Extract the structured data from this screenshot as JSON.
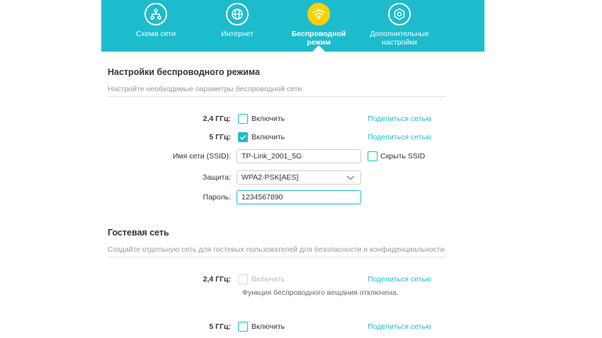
{
  "nav": {
    "items": [
      {
        "label": "Схема сети",
        "icon": "network-map-icon"
      },
      {
        "label": "Интернет",
        "icon": "globe-icon"
      },
      {
        "label": "Беспроводной режим",
        "icon": "wifi-icon"
      },
      {
        "label": "Дополнительные настройки",
        "icon": "gear-icon"
      }
    ],
    "active_index": 2
  },
  "wireless": {
    "title": "Настройки беспроводного режима",
    "description": "Настройте необходимые параметры беспроводной сети.",
    "band24_label": "2,4 ГГц:",
    "band24_enable": "Включить",
    "band24_checked": false,
    "band24_share": "Поделиться сетью",
    "band5_label": "5 ГГц:",
    "band5_enable": "Включить",
    "band5_checked": true,
    "band5_share": "Поделиться сетью",
    "ssid_label": "Имя сети (SSID):",
    "ssid_value": "TP-Link_2001_5G",
    "hide_ssid": "Скрыть SSID",
    "security_label": "Защита:",
    "security_value": "WPA2-PSK[AES]",
    "password_label": "Пароль:",
    "password_value": "1234567890"
  },
  "guest": {
    "title": "Гостевая сеть",
    "description": "Создайте отдельную сеть для гостевых пользователей для безопасности и конфиденциальности.",
    "band24_label": "2,4 ГГц:",
    "band24_enable": "Включить",
    "band24_share": "Поделиться сетью",
    "band24_note": "Функция беспроводного вещания отключена.",
    "band5_label": "5 ГГц:",
    "band5_enable": "Включить",
    "band5_share": "Поделиться сетью"
  },
  "colors": {
    "accent": "#1dbccd",
    "active_icon": "#fad100"
  }
}
